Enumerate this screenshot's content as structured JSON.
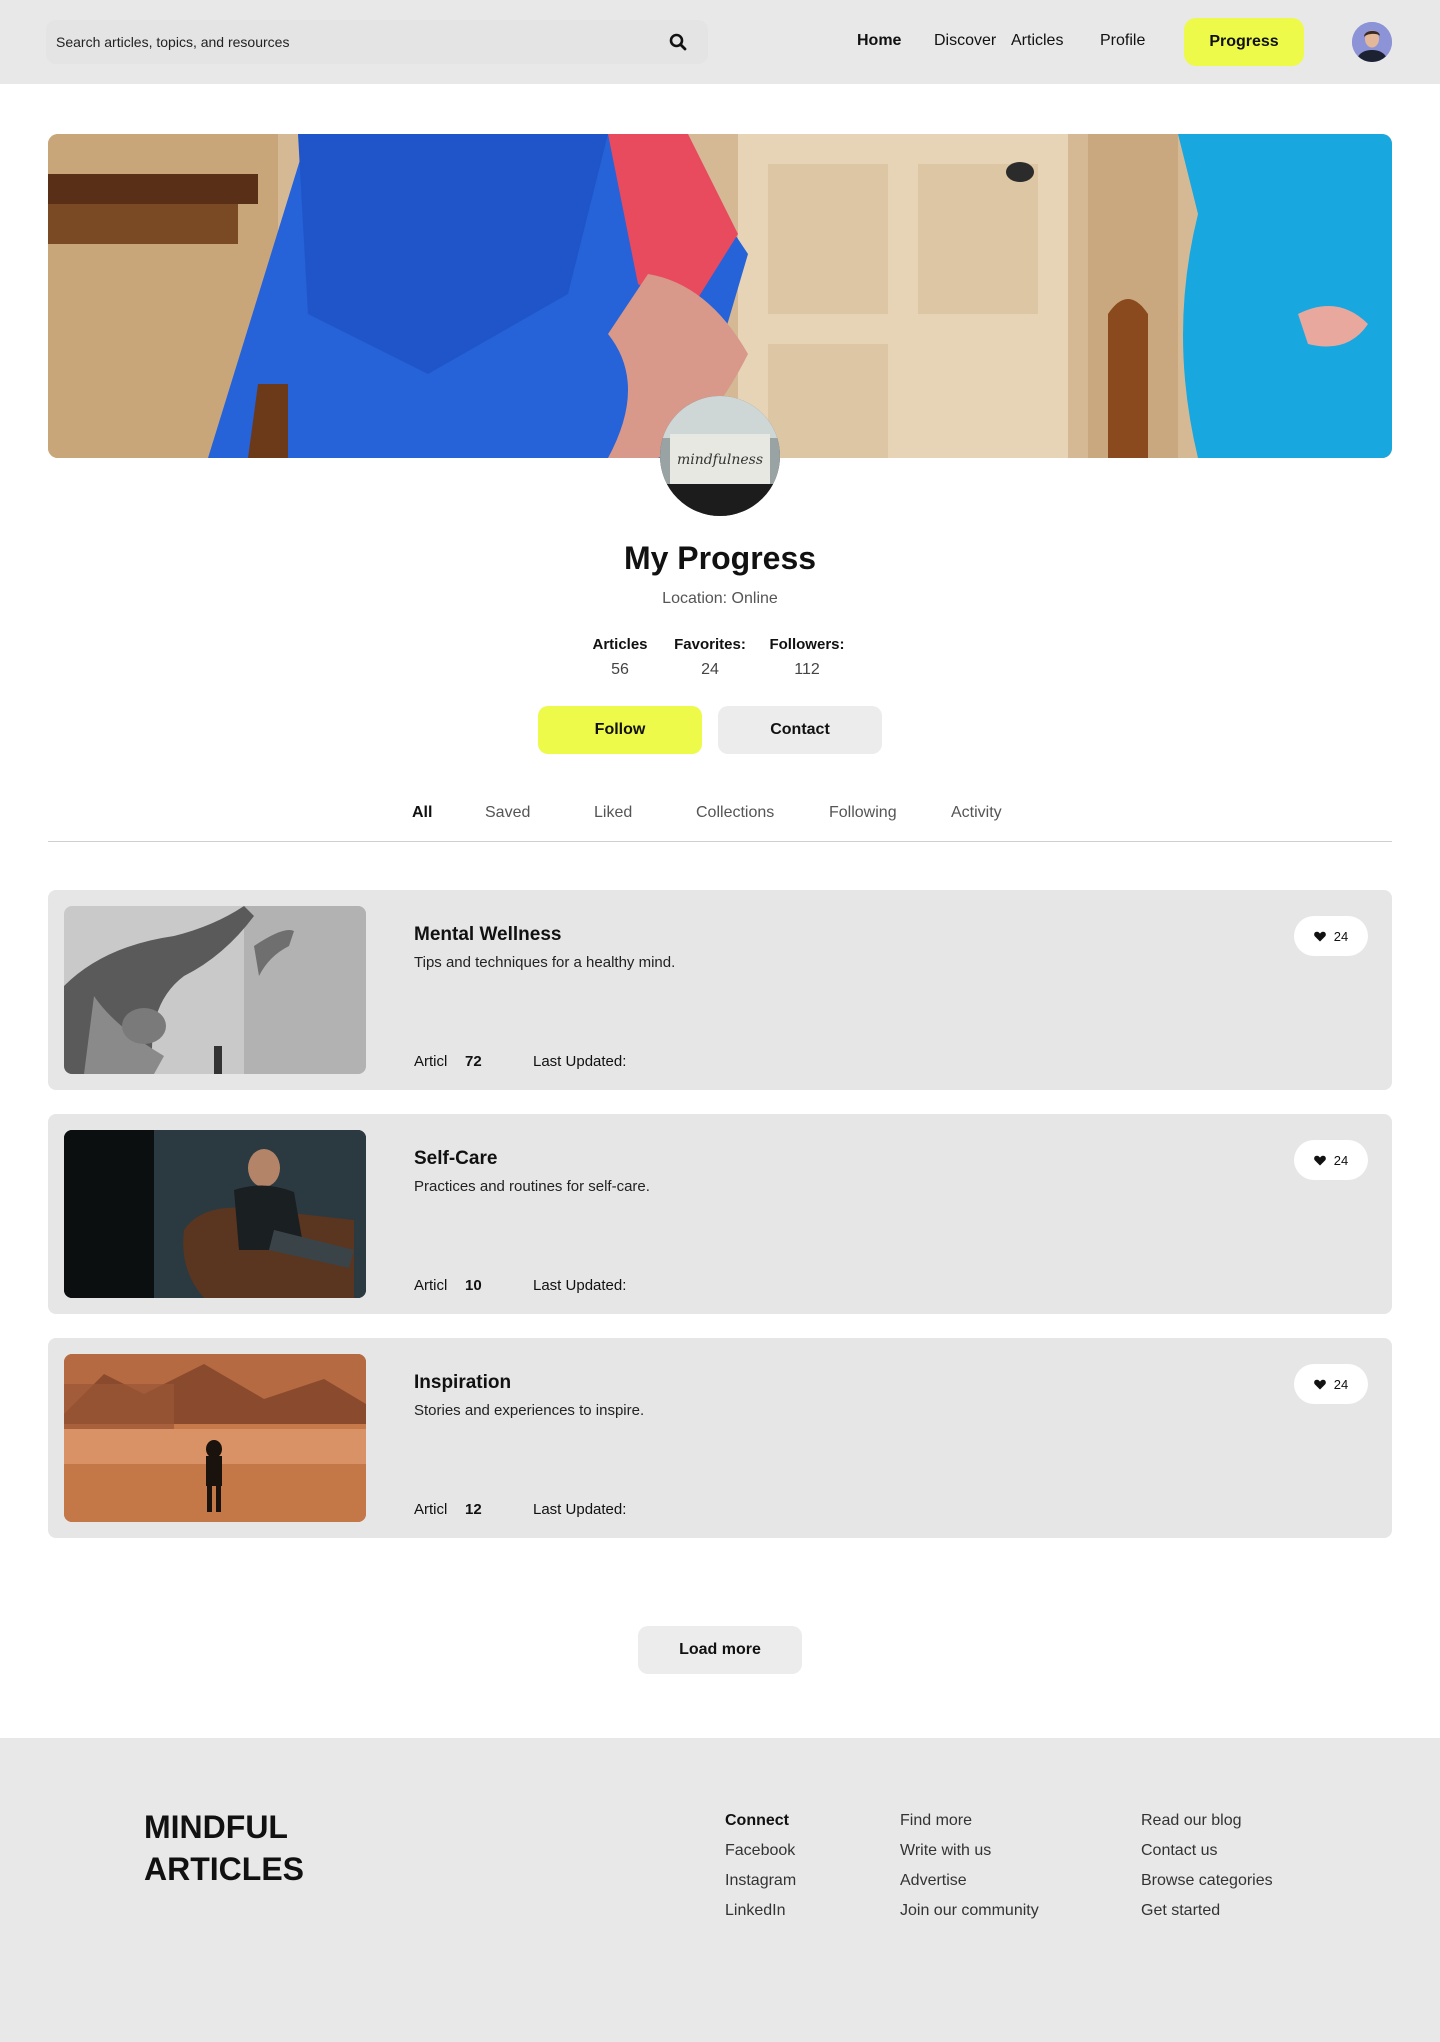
{
  "header": {
    "search_placeholder": "Search articles, topics, and resources",
    "nav": [
      "Home",
      "Discover",
      "Articles",
      "Profile"
    ],
    "progress_label": "Progress"
  },
  "profile": {
    "title": "My Progress",
    "location": "Location: Online",
    "stats": [
      {
        "label": "Articles",
        "value": "56"
      },
      {
        "label": "Favorites:",
        "value": "24"
      },
      {
        "label": "Followers:",
        "value": "112"
      }
    ],
    "follow_label": "Follow",
    "contact_label": "Contact"
  },
  "tabs": [
    "All",
    "Saved",
    "Liked",
    "Collections",
    "Following",
    "Activity"
  ],
  "cards": [
    {
      "title": "Mental Wellness",
      "desc": "Tips and techniques for a healthy mind.",
      "meta_label": "Articl",
      "count": "72",
      "updated": "Last Updated:",
      "likes": "24"
    },
    {
      "title": "Self-Care",
      "desc": "Practices and routines for self-care.",
      "meta_label": "Articl",
      "count": "10",
      "updated": "Last Updated:",
      "likes": "24"
    },
    {
      "title": "Inspiration",
      "desc": "Stories and experiences to inspire.",
      "meta_label": "Articl",
      "count": "12",
      "updated": "Last Updated:",
      "likes": "24"
    }
  ],
  "load_more_label": "Load more",
  "footer": {
    "brand_line1": "MINDFUL",
    "brand_line2": "ARTICLES",
    "col1": [
      "Connect",
      "Facebook",
      "Instagram",
      "LinkedIn"
    ],
    "col2": [
      "Find more",
      "Write with us",
      "Advertise",
      "Join our community"
    ],
    "col3": [
      "Read our blog",
      "Contact us",
      "Browse categories",
      "Get started"
    ]
  },
  "hero_image_text": "mindfulness",
  "colors": {
    "accent": "#edfa4a",
    "panel": "#e6e6e6",
    "header": "#e8e8e8"
  },
  "icons": [
    "search-icon",
    "heart-icon"
  ]
}
